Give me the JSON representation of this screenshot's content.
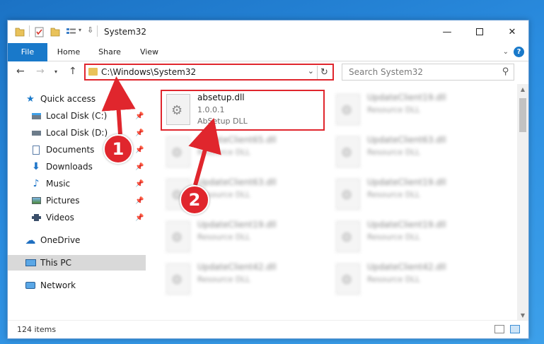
{
  "window": {
    "title": "System32"
  },
  "ribbon": {
    "file": "File",
    "home": "Home",
    "share": "Share",
    "view": "View",
    "help": "?"
  },
  "address": {
    "path": "C:\\Windows\\System32"
  },
  "search": {
    "placeholder": "Search System32"
  },
  "sidebar": {
    "quick_access": "Quick access",
    "items": [
      {
        "label": "Local Disk (C:)"
      },
      {
        "label": "Local Disk (D:)"
      },
      {
        "label": "Documents"
      },
      {
        "label": "Downloads"
      },
      {
        "label": "Music"
      },
      {
        "label": "Pictures"
      },
      {
        "label": "Videos"
      }
    ],
    "onedrive": "OneDrive",
    "thispc": "This PC",
    "network": "Network"
  },
  "files": [
    {
      "name": "absetup.dll",
      "line1": "1.0.0.1",
      "line2": "AbSetup DLL"
    },
    {
      "name": "UpdateClient19.dll",
      "line1": "Resource DLL"
    },
    {
      "name": "UpdateClient65.dll",
      "line1": "Resource DLL"
    },
    {
      "name": "UpdateClient63.dll",
      "line1": "Resource DLL"
    },
    {
      "name": "UpdateClient63.dll",
      "line1": "Resource DLL"
    },
    {
      "name": "UpdateClient19.dll",
      "line1": "Resource DLL"
    },
    {
      "name": "UpdateClient19.dll",
      "line1": "Resource DLL"
    },
    {
      "name": "UpdateClient19.dll",
      "line1": "Resource DLL"
    },
    {
      "name": "UpdateClient42.dll",
      "line1": "Resource DLL"
    },
    {
      "name": "UpdateClient42.dll",
      "line1": "Resource DLL"
    }
  ],
  "status": {
    "count": "124 items"
  },
  "annotations": {
    "step1": "1",
    "step2": "2"
  },
  "colors": {
    "accent": "#1979ca",
    "highlight": "#e0262d"
  }
}
